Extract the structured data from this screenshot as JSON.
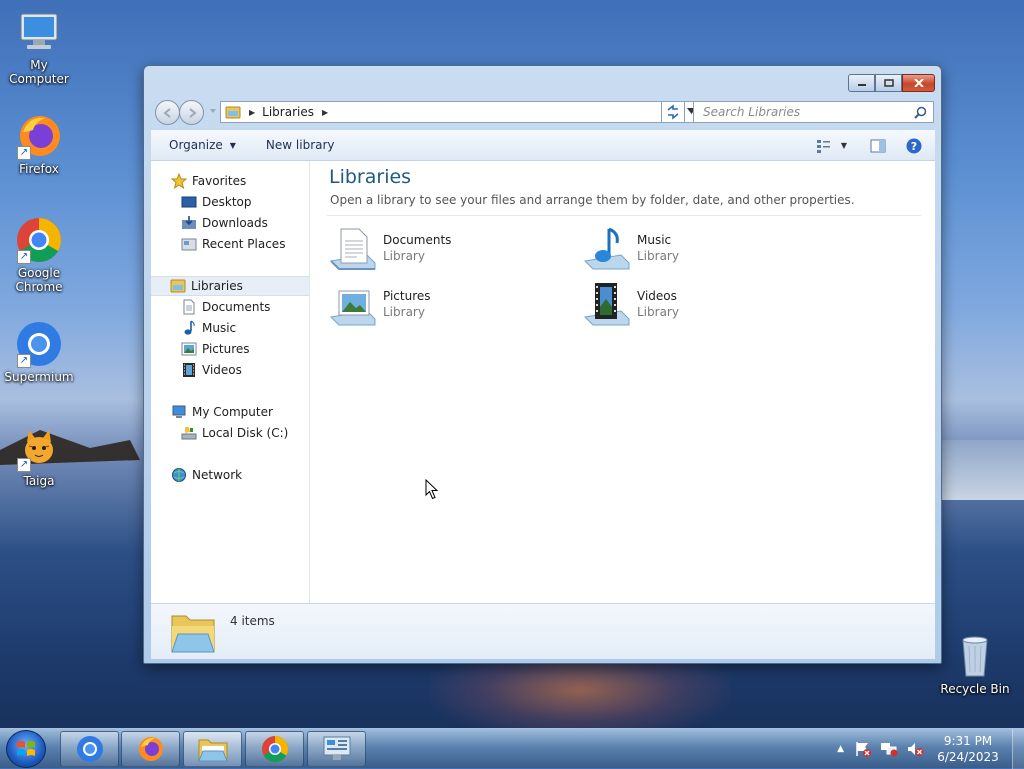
{
  "desktop": {
    "icons": [
      {
        "label": "My Computer",
        "icon": "computer-icon"
      },
      {
        "label": "Firefox",
        "icon": "firefox-icon"
      },
      {
        "label": "Google Chrome",
        "icon": "chrome-icon"
      },
      {
        "label": "Supermium",
        "icon": "supermium-icon"
      },
      {
        "label": "Taiga",
        "icon": "taiga-icon"
      },
      {
        "label": "Recycle Bin",
        "icon": "recycle-bin-icon"
      }
    ]
  },
  "window": {
    "address": {
      "crumb": "Libraries"
    },
    "search": {
      "placeholder": "Search Libraries"
    },
    "toolbar": {
      "organize": "Organize",
      "new_library": "New library"
    },
    "navpane": {
      "favorites": "Favorites",
      "favorites_items": [
        "Desktop",
        "Downloads",
        "Recent Places"
      ],
      "libraries": "Libraries",
      "libraries_items": [
        "Documents",
        "Music",
        "Pictures",
        "Videos"
      ],
      "computer": "My Computer",
      "computer_items": [
        "Local Disk (C:)"
      ],
      "network": "Network"
    },
    "content": {
      "title": "Libraries",
      "subtitle": "Open a library to see your files and arrange them by folder, date, and other properties.",
      "libraries": [
        {
          "name": "Documents",
          "type": "Library",
          "icon": "documents-library-icon"
        },
        {
          "name": "Music",
          "type": "Library",
          "icon": "music-library-icon"
        },
        {
          "name": "Pictures",
          "type": "Library",
          "icon": "pictures-library-icon"
        },
        {
          "name": "Videos",
          "type": "Library",
          "icon": "videos-library-icon"
        }
      ]
    },
    "details": {
      "count": "4 items"
    }
  },
  "taskbar": {
    "items": [
      "supermium-icon",
      "firefox-icon",
      "explorer-icon",
      "chrome-icon",
      "control-panel-icon"
    ],
    "active": "explorer-icon",
    "clock": {
      "time": "9:31 PM",
      "date": "6/24/2023"
    }
  },
  "colors": {
    "title_blue": "#1e5a84",
    "taskbar": "#3c5f8c",
    "close_red": "#c7472c"
  }
}
